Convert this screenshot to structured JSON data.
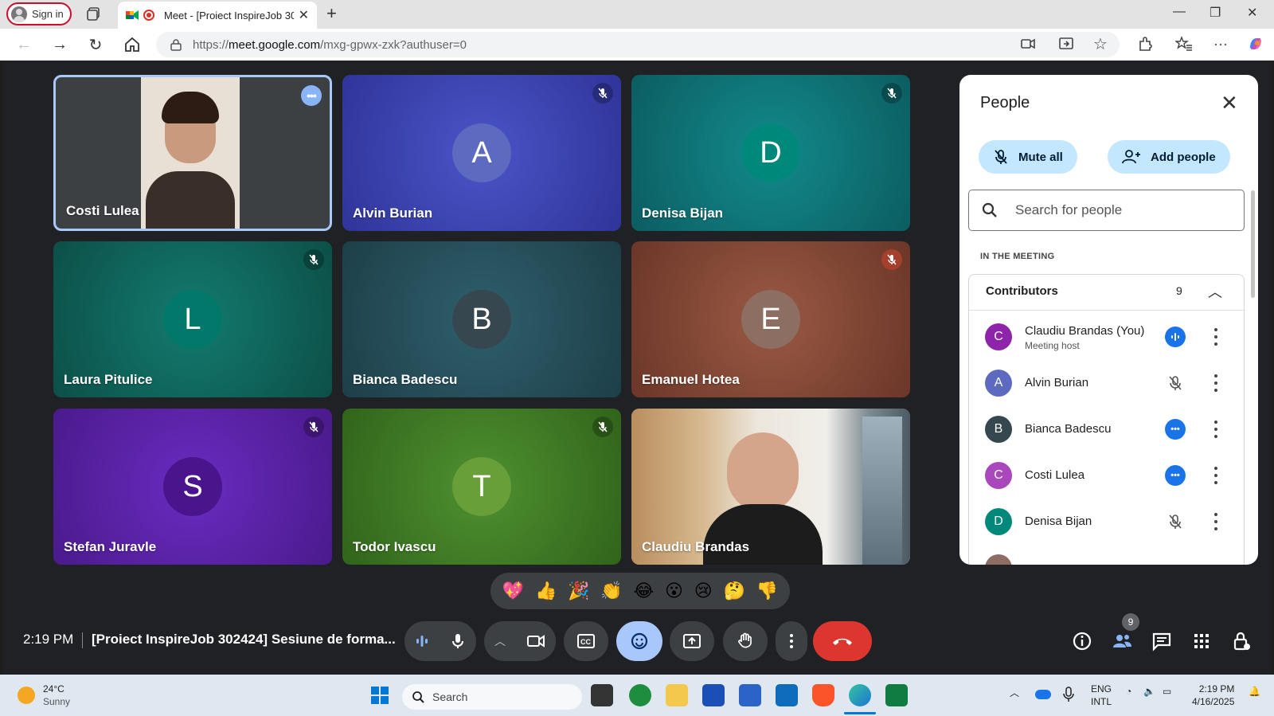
{
  "browser": {
    "signin_label": "Sign in",
    "tab_title": "Meet - [Proiect InspireJob 30",
    "url_prefix": "https://",
    "url_host": "meet.google.com",
    "url_path": "/mxg-gpwx-zxk?authuser=0"
  },
  "tiles": [
    {
      "name": "Costi Lulea",
      "initial": "",
      "status": "more",
      "bg": "#3c4043",
      "video": true
    },
    {
      "name": "Alvin Burian",
      "initial": "A",
      "status": "muted",
      "bg": "#3b40a8",
      "avatar": "#5c6bc0"
    },
    {
      "name": "Denisa Bijan",
      "initial": "D",
      "status": "muted",
      "bg": "#0d6b6f",
      "avatar": "#00897b"
    },
    {
      "name": "Laura Pitulice",
      "initial": "L",
      "status": "muted",
      "bg": "#0e5f57",
      "avatar": "#00796b"
    },
    {
      "name": "Bianca Badescu",
      "initial": "B",
      "status": "",
      "bg": "#234d58",
      "avatar": "#37474f"
    },
    {
      "name": "Emanuel Hotea",
      "initial": "E",
      "status": "muted-red",
      "bg": "#7a4233",
      "avatar": "#8d6e63"
    },
    {
      "name": "Stefan Juravle",
      "initial": "S",
      "status": "muted",
      "bg": "#5a1fa3",
      "avatar": "#4a148c"
    },
    {
      "name": "Todor Ivascu",
      "initial": "T",
      "status": "muted",
      "bg": "#3f7a20",
      "avatar": "#689f38"
    },
    {
      "name": "Claudiu Brandas",
      "initial": "",
      "status": "",
      "bg": "#c8c0b4",
      "video": true
    }
  ],
  "people_panel": {
    "title": "People",
    "mute_all": "Mute all",
    "add_people": "Add people",
    "search_placeholder": "Search for people",
    "section_label": "IN THE MEETING",
    "group_label": "Contributors",
    "group_count": "9",
    "rows": [
      {
        "name": "Claudiu Brandas (You)",
        "role": "Meeting host",
        "initial": "C",
        "color": "#8e24aa",
        "status": "speaking"
      },
      {
        "name": "Alvin Burian",
        "role": "",
        "initial": "A",
        "color": "#5c6bc0",
        "status": "muted"
      },
      {
        "name": "Bianca Badescu",
        "role": "",
        "initial": "B",
        "color": "#37474f",
        "status": "more"
      },
      {
        "name": "Costi Lulea",
        "role": "",
        "initial": "C",
        "color": "#ab47bc",
        "status": "more"
      },
      {
        "name": "Denisa Bijan",
        "role": "",
        "initial": "D",
        "color": "#00897b",
        "status": "muted"
      }
    ]
  },
  "reactions": [
    "💖",
    "👍",
    "🎉",
    "👏",
    "😂",
    "😮",
    "😢",
    "🤔",
    "👎"
  ],
  "bottom_bar": {
    "time": "2:19 PM",
    "meeting_title": "[Proiect InspireJob 302424] Sesiune de forma...",
    "people_count": "9"
  },
  "taskbar": {
    "temp": "24°C",
    "condition": "Sunny",
    "search_label": "Search",
    "lang1": "ENG",
    "lang2": "INTL",
    "time": "2:19 PM",
    "date": "4/16/2025"
  }
}
